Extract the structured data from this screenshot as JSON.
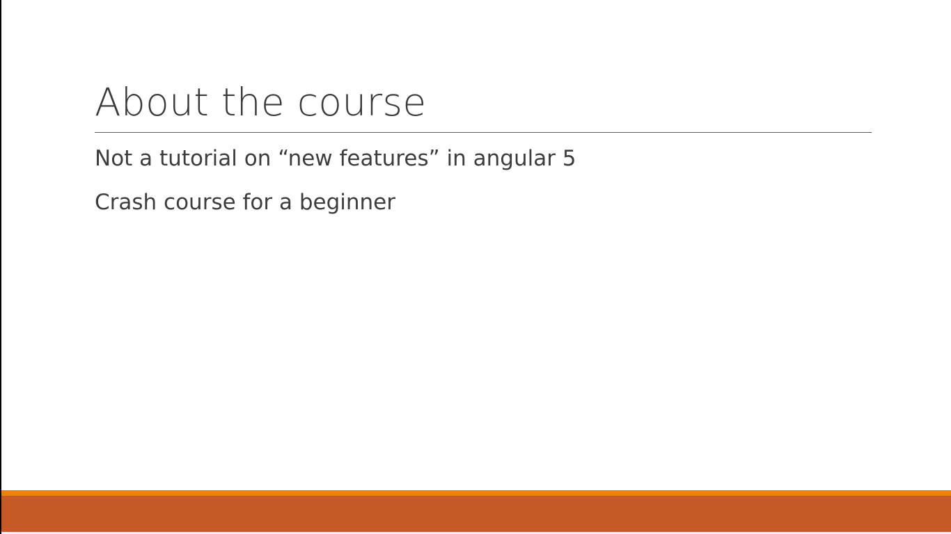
{
  "slide": {
    "title": "About the course",
    "bullets": [
      "Not a tutorial on “new features” in angular 5",
      "Crash course for a beginner"
    ]
  },
  "theme": {
    "footer_accent": "#e8830f",
    "footer_band": "#c55a26",
    "title_color": "#3a3a3a",
    "text_color": "#3d3d3d"
  }
}
